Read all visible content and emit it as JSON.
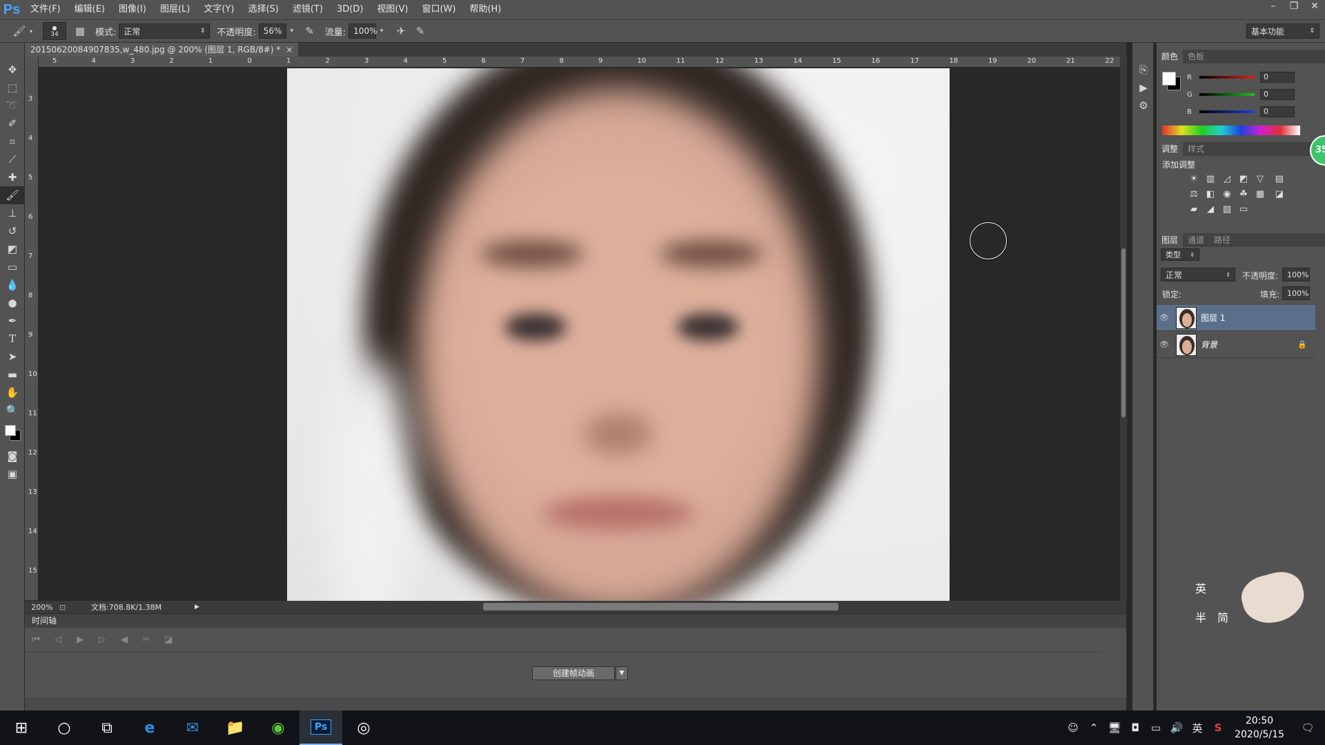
{
  "app": {
    "logo": "Ps"
  },
  "menu": [
    "文件(F)",
    "编辑(E)",
    "图像(I)",
    "图层(L)",
    "文字(Y)",
    "选择(S)",
    "滤镜(T)",
    "3D(D)",
    "视图(V)",
    "窗口(W)",
    "帮助(H)"
  ],
  "window_controls": {
    "min": "–",
    "restore": "❐",
    "close": "✕"
  },
  "options": {
    "brush_size": "34",
    "mode_label": "模式:",
    "mode_value": "正常",
    "opacity_label": "不透明度:",
    "opacity_value": "56%",
    "flow_label": "流量:",
    "flow_value": "100%",
    "workspace": "基本功能"
  },
  "document": {
    "tab_title": "20150620084907835,w_480.jpg @ 200% (图层 1, RGB/8#) *",
    "tab_close": "×",
    "zoom": "200%",
    "doc_info": "文档:708.8K/1.38M"
  },
  "ruler_top": [
    "5",
    "4",
    "3",
    "2",
    "1",
    "0",
    "1",
    "2",
    "3",
    "4",
    "5",
    "6",
    "7",
    "8",
    "9",
    "10",
    "11",
    "12",
    "13",
    "14",
    "15",
    "16",
    "17",
    "18",
    "19",
    "20",
    "21",
    "22"
  ],
  "ruler_left": [
    "3",
    "4",
    "5",
    "6",
    "7",
    "8",
    "9",
    "10",
    "11",
    "12",
    "13",
    "14",
    "15"
  ],
  "timeline": {
    "title": "时间轴",
    "create_button": "创建帧动画"
  },
  "color_panel": {
    "tabs": [
      "颜色",
      "色板"
    ],
    "channels": [
      {
        "label": "R",
        "value": "0",
        "color": "#e02020"
      },
      {
        "label": "G",
        "value": "0",
        "color": "#20c020"
      },
      {
        "label": "B",
        "value": "0",
        "color": "#2040e0"
      }
    ]
  },
  "adjust_panel": {
    "tabs": [
      "调整",
      "样式"
    ],
    "title": "添加调整"
  },
  "layers_panel": {
    "tabs": [
      "图层",
      "通道",
      "路径"
    ],
    "filter_kind": "类型",
    "blend_mode": "正常",
    "opacity_label": "不透明度:",
    "opacity_value": "100%",
    "lock_label": "锁定:",
    "fill_label": "填充:",
    "fill_value": "100%",
    "layers": [
      {
        "name": "图层 1",
        "selected": true
      },
      {
        "name": "背景",
        "locked": true
      }
    ]
  },
  "overlay_badge": "35",
  "widget": {
    "text1": "英",
    "text2": "半",
    "text3": "简"
  },
  "taskbar": {
    "ime": "英",
    "time": "20:50",
    "date": "2020/5/15"
  }
}
